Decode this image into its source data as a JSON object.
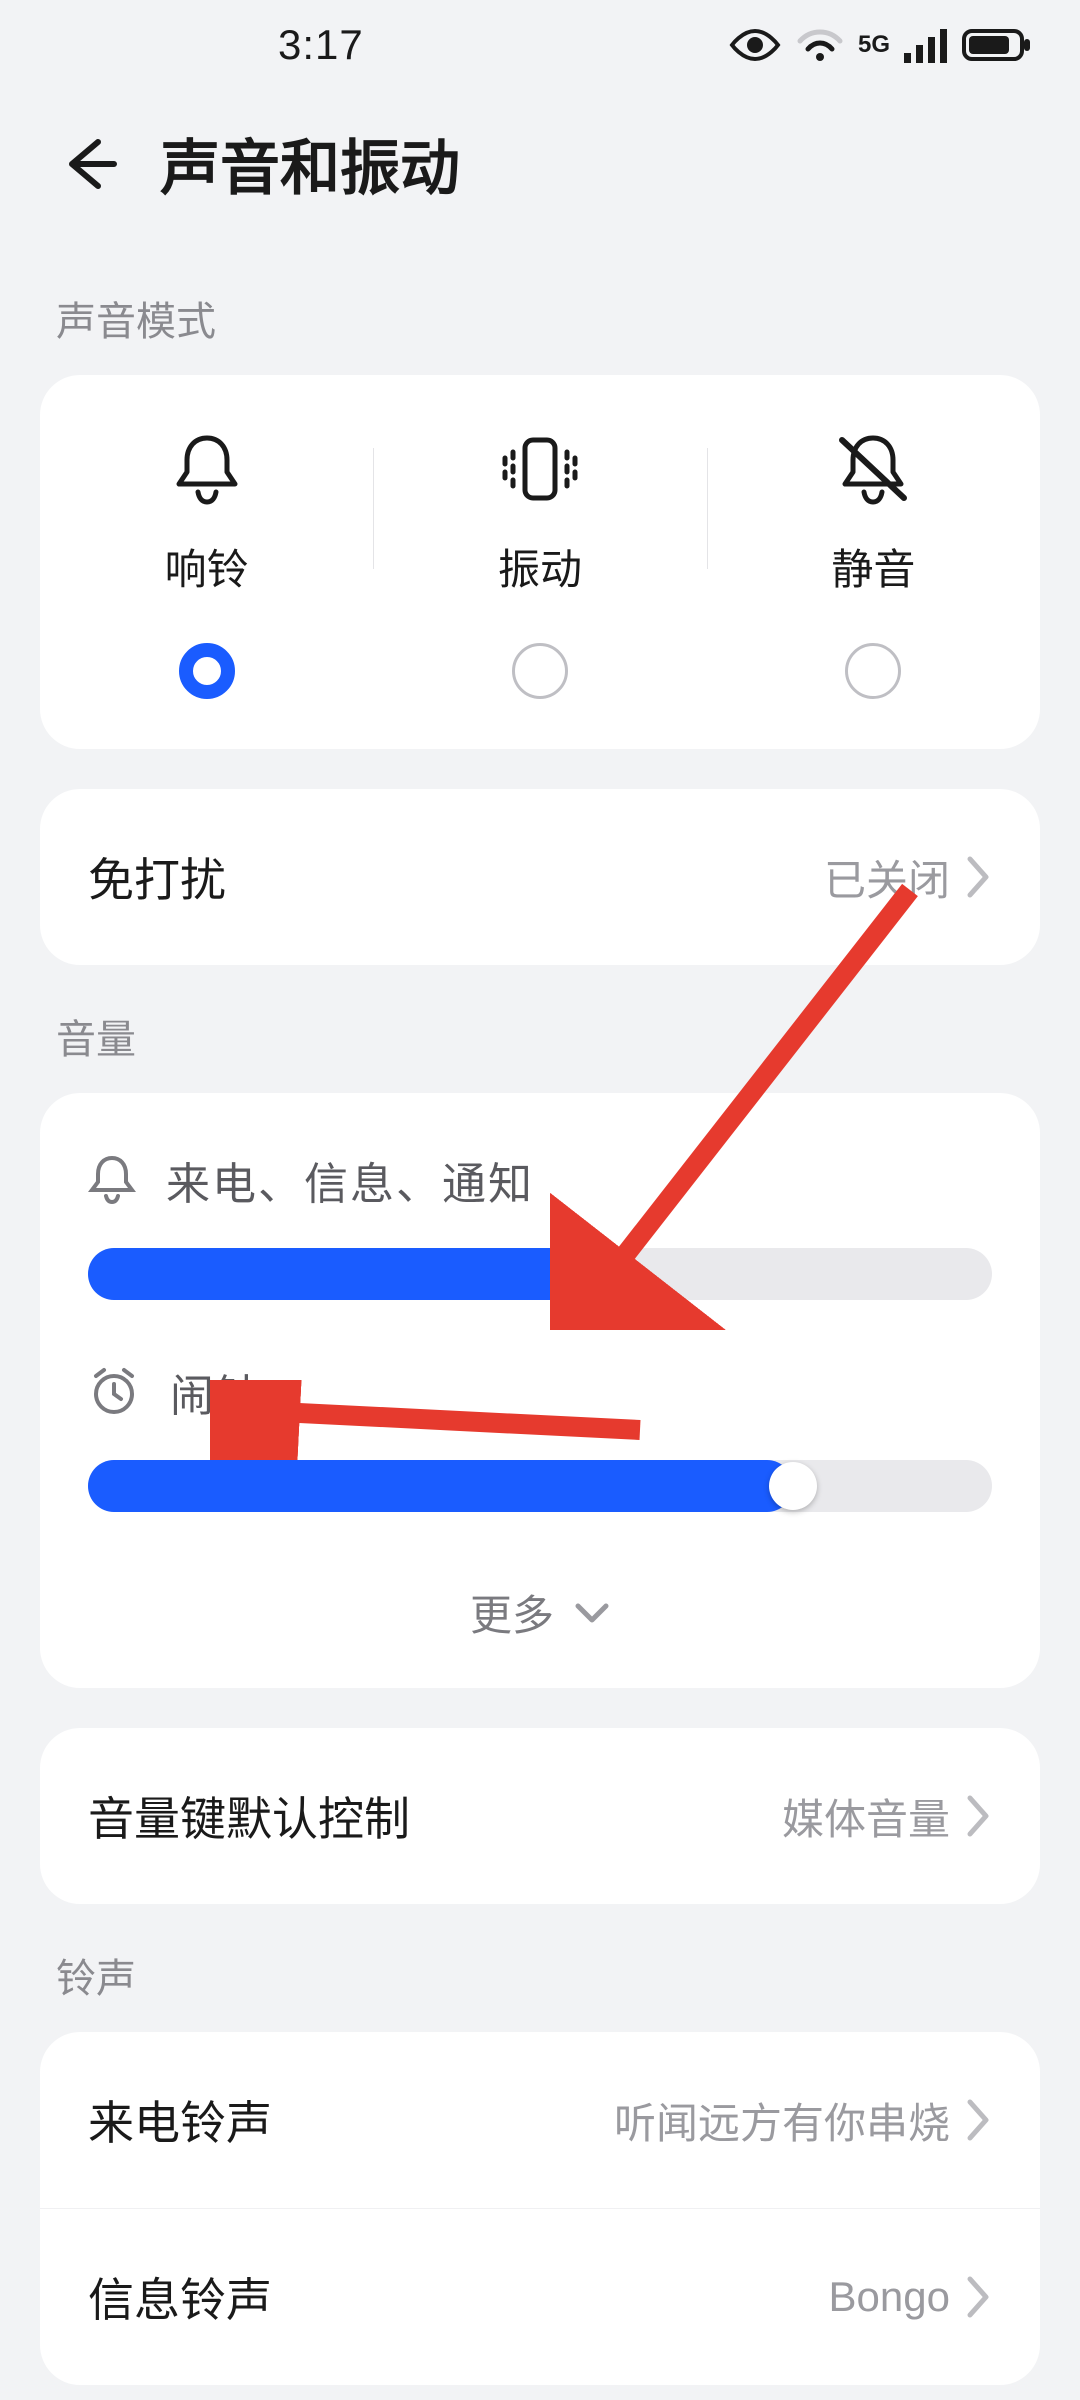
{
  "status": {
    "time": "3:17"
  },
  "header": {
    "title": "声音和振动"
  },
  "sections": {
    "sound_mode": "声音模式",
    "volume": "音量",
    "ringtone": "铃声"
  },
  "modes": {
    "ring": "响铃",
    "vibrate": "振动",
    "silent": "静音",
    "selected": "ring"
  },
  "dnd": {
    "title": "免打扰",
    "value": "已关闭"
  },
  "volumes": {
    "ringtone": {
      "label": "来电、信息、通知",
      "percent": 55
    },
    "alarm": {
      "label": "闹钟",
      "percent": 78
    },
    "more": "更多"
  },
  "vol_key": {
    "title": "音量键默认控制",
    "value": "媒体音量"
  },
  "ringtones": {
    "incoming": {
      "title": "来电铃声",
      "value": "听闻远方有你串烧"
    },
    "message": {
      "title": "信息铃声",
      "value": "Bongo"
    }
  },
  "colors": {
    "accent": "#1a5cff",
    "arrow": "#e63a2e"
  }
}
